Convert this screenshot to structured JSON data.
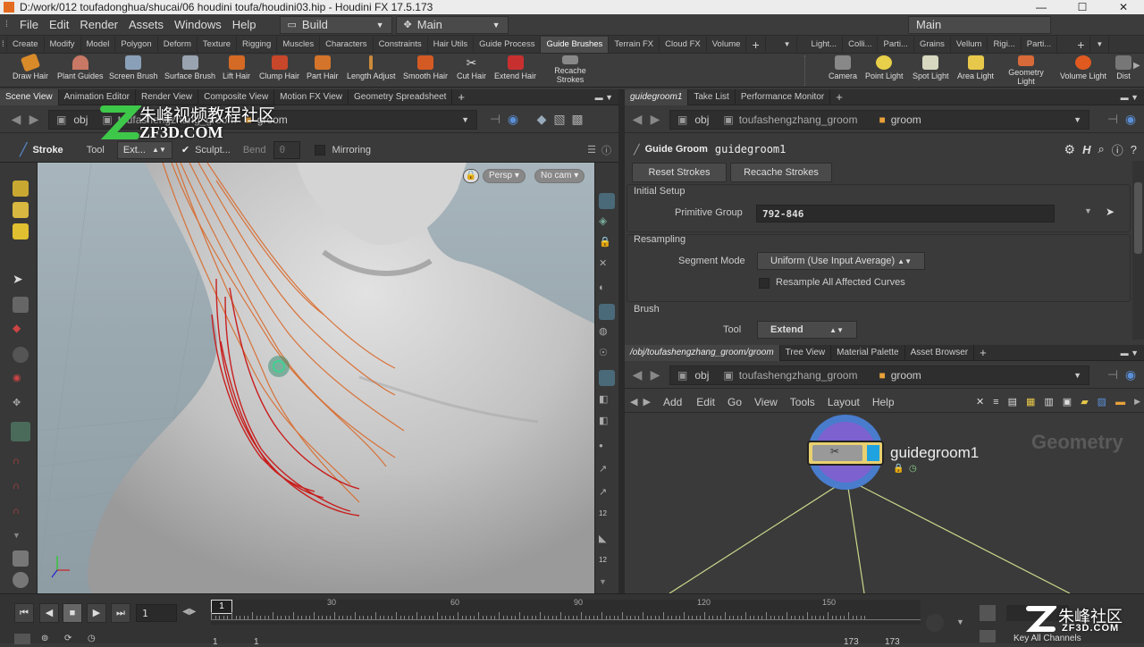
{
  "window": {
    "title": "D:/work/012 toufadonghua/shucai/06 houdini toufa/houdini03.hip - Houdini FX 17.5.173"
  },
  "menu": {
    "items": [
      "File",
      "Edit",
      "Render",
      "Assets",
      "Windows",
      "Help"
    ],
    "desktop": "Build",
    "desktop_right": "Main",
    "right_main": "Main"
  },
  "shelf": {
    "tabs": [
      "Create",
      "Modify",
      "Model",
      "Polygon",
      "Deform",
      "Texture",
      "Rigging",
      "Muscles",
      "Characters",
      "Constraints",
      "Hair Utils",
      "Guide Process",
      "Guide Brushes",
      "Terrain FX",
      "Cloud FX",
      "Volume"
    ],
    "right_tabs": [
      "Light...",
      "Colli...",
      "Parti...",
      "Grains",
      "Vellum",
      "Rigi...",
      "Parti..."
    ],
    "tools": [
      "Draw Hair",
      "Plant Guides",
      "Screen Brush",
      "Surface Brush",
      "Lift Hair",
      "Clump Hair",
      "Part Hair",
      "Length Adjust",
      "Smooth Hair",
      "Cut Hair",
      "Extend Hair",
      "Recache Strokes"
    ],
    "right_tools": [
      "Camera",
      "Point Light",
      "Spot Light",
      "Area Light",
      "Geometry Light",
      "Volume Light",
      "Dist"
    ]
  },
  "left_pane": {
    "tabs": [
      "Scene View",
      "Animation Editor",
      "Render View",
      "Composite View",
      "Motion FX View",
      "Geometry Spreadsheet"
    ],
    "path": {
      "obj": "obj",
      "node1": "toufashengzhang_groom",
      "node2": "groom"
    },
    "toolbar": {
      "stroke": "Stroke",
      "tool": "Tool",
      "ext": "Ext...",
      "sculpt": "Sculpt...",
      "bend": "Bend",
      "bend_val": "0",
      "mirroring": "Mirroring"
    },
    "view": {
      "persp": "Persp",
      "cam": "No cam"
    },
    "watermark": {
      "cn": "朱峰视频教程社区",
      "en": "ZF3D.COM"
    }
  },
  "param_pane": {
    "tabs": [
      "guidegroom1",
      "Take List",
      "Performance Monitor"
    ],
    "path": {
      "obj": "obj",
      "node1": "toufashengzhang_groom",
      "node2": "groom"
    },
    "node_type": "Guide Groom",
    "node_name": "guidegroom1",
    "buttons": {
      "reset": "Reset Strokes",
      "recache": "Recache Strokes"
    },
    "sections": {
      "initial": "Initial Setup",
      "resampling": "Resampling",
      "brush": "Brush"
    },
    "primitive_group": {
      "label": "Primitive Group",
      "value": "792-846"
    },
    "segment_mode": {
      "label": "Segment Mode",
      "value": "Uniform (Use Input Average)"
    },
    "resample_all": "Resample All Affected Curves",
    "tool": {
      "label": "Tool",
      "value": "Extend"
    }
  },
  "network_pane": {
    "tabs": [
      "/obj/toufashengzhang_groom/groom",
      "Tree View",
      "Material Palette",
      "Asset Browser"
    ],
    "path": {
      "obj": "obj",
      "node1": "toufashengzhang_groom",
      "node2": "groom"
    },
    "menu": [
      "Add",
      "Edit",
      "Go",
      "View",
      "Tools",
      "Layout",
      "Help"
    ],
    "context_label": "Geometry",
    "node_label": "guidegroom1"
  },
  "timeline": {
    "frame": "1",
    "ticks": [
      "1",
      "30",
      "60",
      "90",
      "120",
      "150"
    ],
    "start": "1",
    "start2": "1",
    "end": "173",
    "end2": "173",
    "key_all": "Key All Channels",
    "watermark_cn": "朱峰社区",
    "watermark_en": "ZF3D.COM"
  },
  "colors": {
    "accent": "#e8a13a",
    "hair_orange": "#d9692a",
    "hair_red": "#c81e1e",
    "node_blue": "#4a7fd4"
  }
}
